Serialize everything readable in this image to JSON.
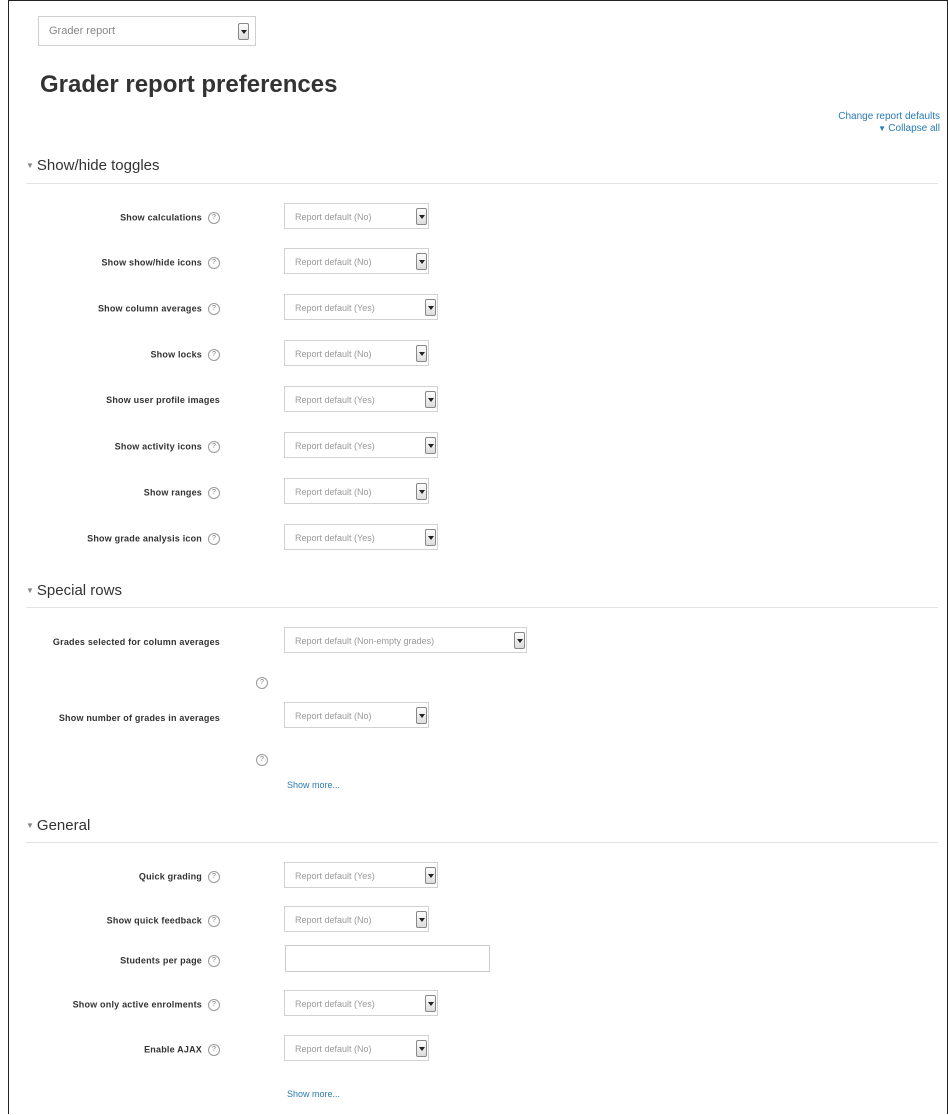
{
  "report_selector": {
    "value": "Grader report"
  },
  "page_title": "Grader report preferences",
  "links": {
    "change_defaults": "Change report defaults",
    "collapse_all": "Collapse all"
  },
  "sections": {
    "toggles": {
      "title": "Show/hide toggles",
      "rows": [
        {
          "label": "Show calculations",
          "value": "Report default (No)"
        },
        {
          "label": "Show show/hide icons",
          "value": "Report default (No)"
        },
        {
          "label": "Show column averages",
          "value": "Report default (Yes)"
        },
        {
          "label": "Show locks",
          "value": "Report default (No)"
        },
        {
          "label": "Show user profile images",
          "value": "Report default (Yes)"
        },
        {
          "label": "Show activity icons",
          "value": "Report default (Yes)"
        },
        {
          "label": "Show ranges",
          "value": "Report default (No)"
        },
        {
          "label": "Show grade analysis icon",
          "value": "Report default (Yes)"
        }
      ]
    },
    "special": {
      "title": "Special rows",
      "rows": [
        {
          "label": "Grades selected for column averages",
          "value": "Report default (Non-empty grades)"
        },
        {
          "label": "Show number of grades in averages",
          "value": "Report default (No)"
        }
      ],
      "show_more": "Show more..."
    },
    "general": {
      "title": "General",
      "rows": [
        {
          "label": "Quick grading",
          "value": "Report default (Yes)"
        },
        {
          "label": "Show quick feedback",
          "value": "Report default (No)"
        },
        {
          "label": "Students per page",
          "value": ""
        },
        {
          "label": "Show only active enrolments",
          "value": "Report default (Yes)"
        },
        {
          "label": "Enable AJAX",
          "value": "Report default (No)"
        }
      ],
      "show_more": "Show more..."
    }
  },
  "icons": {
    "help": "help-icon",
    "section_toggle": "collapse-triangle-icon",
    "dropdown": "dropdown-arrow-icon"
  },
  "colors": {
    "link": "#2a7bb5",
    "text": "#333333",
    "border": "#222222"
  }
}
